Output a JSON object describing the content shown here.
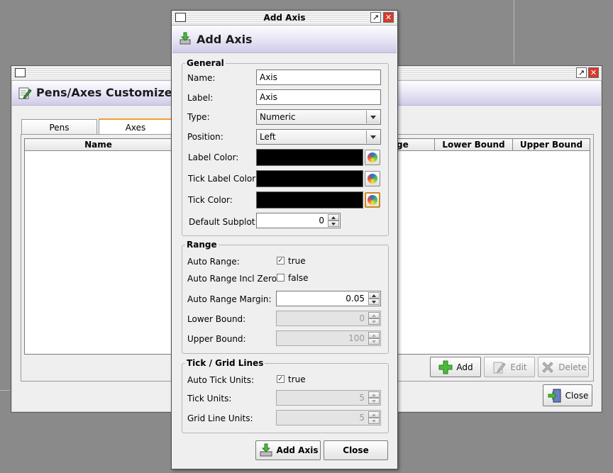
{
  "background_window": {
    "title": "Pens/Axes Customizer",
    "tabs": [
      {
        "label": "Pens"
      },
      {
        "label": "Axes"
      }
    ],
    "table_columns": {
      "name": "Name",
      "range": "ge",
      "lower_bound": "Lower Bound",
      "upper_bound": "Upper Bound"
    },
    "buttons": {
      "add": "Add",
      "edit": "Edit",
      "delete": "Delete",
      "close": "Close"
    }
  },
  "dialog": {
    "window_title": "Add Axis",
    "header_title": "Add Axis",
    "general": {
      "legend": "General",
      "name_label": "Name:",
      "name_value": "Axis",
      "label_label": "Label:",
      "label_value": "Axis",
      "type_label": "Type:",
      "type_value": "Numeric",
      "position_label": "Position:",
      "position_value": "Left",
      "label_color_label": "Label Color:",
      "tick_label_color_label": "Tick Label Color:",
      "tick_color_label": "Tick Color:",
      "default_subplot_label": "Default Subplot:",
      "default_subplot_value": "0"
    },
    "range": {
      "legend": "Range",
      "auto_range_label": "Auto Range:",
      "auto_range_value": "true",
      "auto_range_incl_zero_label": "Auto Range Incl Zero:",
      "auto_range_incl_zero_value": "false",
      "auto_range_margin_label": "Auto Range Margin:",
      "auto_range_margin_value": "0.05",
      "lower_bound_label": "Lower Bound:",
      "lower_bound_value": "0",
      "upper_bound_label": "Upper Bound:",
      "upper_bound_value": "100"
    },
    "tick_grid": {
      "legend": "Tick / Grid Lines",
      "auto_tick_units_label": "Auto Tick Units:",
      "auto_tick_units_value": "true",
      "tick_units_label": "Tick Units:",
      "tick_units_value": "5",
      "grid_line_units_label": "Grid Line Units:",
      "grid_line_units_value": "5"
    },
    "buttons": {
      "add_axis": "Add Axis",
      "close": "Close"
    }
  },
  "colors": {
    "label_color": "#000000",
    "tick_label_color": "#000000",
    "tick_color": "#000000",
    "tab_accent": "#f0a030",
    "close_button": "#d83a2a"
  }
}
